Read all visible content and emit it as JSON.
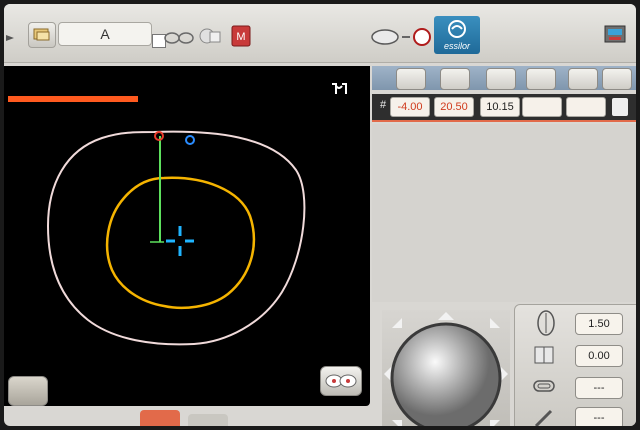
{
  "toolbar": {
    "job_label": "A",
    "brand_name": "essilor"
  },
  "readouts": {
    "hash": "#",
    "values": [
      "-4.00",
      "20.50",
      "10.15",
      "",
      ""
    ]
  },
  "controls": {
    "values": [
      "1.50",
      "0.00",
      "---",
      "---"
    ]
  },
  "colors": {
    "frame_outline": "#f0dada",
    "lens_outline": "#f5b400",
    "axis_line": "#5de05d",
    "center_cross": "#1fb5ff",
    "marker_red": "#e83a2a",
    "marker_blue": "#2a8cff",
    "progress_bar": "#ff5a1f"
  }
}
